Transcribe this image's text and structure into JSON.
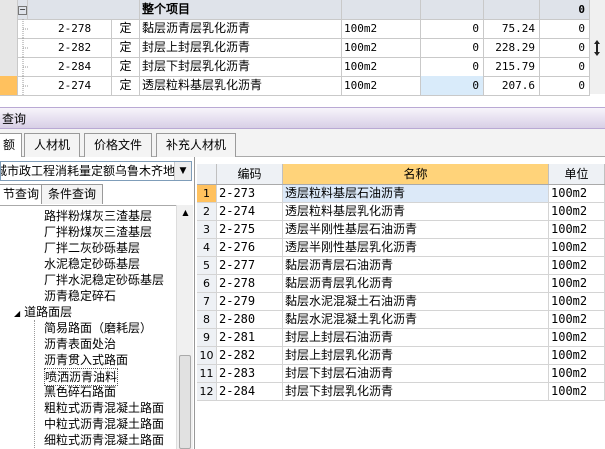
{
  "top_grid": {
    "header": {
      "expander": "−",
      "name": "整个项目",
      "last_value": "0"
    },
    "rows": [
      {
        "code": "2-278",
        "type": "定",
        "name": "黏层沥青层乳化沥青",
        "unit": "100m2",
        "qty": "0",
        "price": "75.24",
        "total": "0",
        "selected": false
      },
      {
        "code": "2-282",
        "type": "定",
        "name": "封层上封层乳化沥青",
        "unit": "100m2",
        "qty": "0",
        "price": "228.29",
        "total": "0",
        "selected": false
      },
      {
        "code": "2-284",
        "type": "定",
        "name": "封层下封层乳化沥青",
        "unit": "100m2",
        "qty": "0",
        "price": "215.79",
        "total": "0",
        "selected": false
      },
      {
        "code": "2-274",
        "type": "定",
        "name": "透层粒料基层乳化沥青",
        "unit": "100m2",
        "qty": "0",
        "price": "207.6",
        "total": "0",
        "selected": true
      }
    ]
  },
  "query_panel": {
    "title": "查询",
    "tabs": [
      "额",
      "人材机",
      "价格文件",
      "补充人材机"
    ],
    "active_tab": 0,
    "region_select": "城市政工程消耗量定额乌鲁木齐地",
    "subtabs": [
      "节查询",
      "条件查询"
    ],
    "tree": [
      {
        "label": "路拌粉煤灰三渣基层",
        "level": 2
      },
      {
        "label": "厂拌粉煤灰三渣基层",
        "level": 2
      },
      {
        "label": "厂拌二灰砂砾基层",
        "level": 2
      },
      {
        "label": "水泥稳定砂砾基层",
        "level": 2
      },
      {
        "label": "厂拌水泥稳定砂砾基层",
        "level": 2
      },
      {
        "label": "沥青稳定碎石",
        "level": 2
      },
      {
        "label": "道路面层",
        "level": 1,
        "expander": "◢"
      },
      {
        "label": "简易路面（磨耗层）",
        "level": 2
      },
      {
        "label": "沥青表面处治",
        "level": 2
      },
      {
        "label": "沥青贯入式路面",
        "level": 2
      },
      {
        "label": "喷洒沥青油料",
        "level": 2,
        "selected": true
      },
      {
        "label": "黑色碎石路面",
        "level": 2
      },
      {
        "label": "粗粒式沥青混凝土路面",
        "level": 2
      },
      {
        "label": "中粒式沥青混凝土路面",
        "level": 2
      },
      {
        "label": "细粒式沥青混凝土路面",
        "level": 2
      }
    ]
  },
  "result_grid": {
    "columns": {
      "code": "编码",
      "name": "名称",
      "unit": "单位"
    },
    "rows": [
      {
        "idx": "1",
        "code": "2-273",
        "name": "透层粒料基层石油沥青",
        "unit": "100m2"
      },
      {
        "idx": "2",
        "code": "2-274",
        "name": "透层粒料基层乳化沥青",
        "unit": "100m2"
      },
      {
        "idx": "3",
        "code": "2-275",
        "name": "透层半刚性基层石油沥青",
        "unit": "100m2"
      },
      {
        "idx": "4",
        "code": "2-276",
        "name": "透层半刚性基层乳化沥青",
        "unit": "100m2"
      },
      {
        "idx": "5",
        "code": "2-277",
        "name": "黏层沥青层石油沥青",
        "unit": "100m2"
      },
      {
        "idx": "6",
        "code": "2-278",
        "name": "黏层沥青层乳化沥青",
        "unit": "100m2"
      },
      {
        "idx": "7",
        "code": "2-279",
        "name": "黏层水泥混凝土石油沥青",
        "unit": "100m2"
      },
      {
        "idx": "8",
        "code": "2-280",
        "name": "黏层水泥混凝土乳化沥青",
        "unit": "100m2"
      },
      {
        "idx": "9",
        "code": "2-281",
        "name": "封层上封层石油沥青",
        "unit": "100m2"
      },
      {
        "idx": "10",
        "code": "2-282",
        "name": "封层上封层乳化沥青",
        "unit": "100m2"
      },
      {
        "idx": "11",
        "code": "2-283",
        "name": "封层下封层石油沥青",
        "unit": "100m2"
      },
      {
        "idx": "12",
        "code": "2-284",
        "name": "封层下封层乳化沥青",
        "unit": "100m2"
      }
    ],
    "highlight_row": 0
  },
  "colors": {
    "name_header": "#ffd37a",
    "row_highlight": "#dce9f8",
    "selected_orange": "#ffc15e",
    "selected_cell": "#d9ebfa"
  }
}
